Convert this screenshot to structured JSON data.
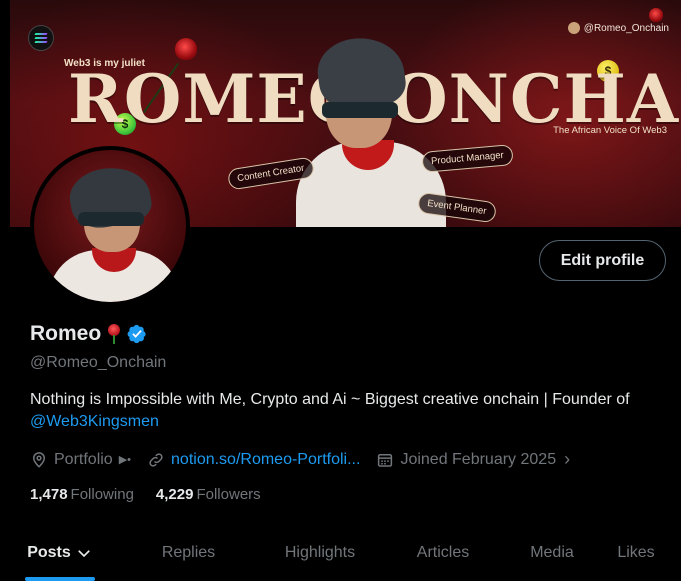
{
  "banner": {
    "tagline_left": "Web3 is my juliet",
    "headline": "ROMEO ONCHAIN",
    "handle": "@Romeo_Onchain",
    "tagline_right": "The African Voice Of Web3",
    "pills": [
      "Content Creator",
      "Product Manager",
      "Event Planner"
    ]
  },
  "profile": {
    "display_name": "Romeo",
    "handle": "@Romeo_Onchain",
    "edit_button": "Edit profile",
    "bio_text": "Nothing is Impossible with Me, Crypto and Ai  ~ Biggest creative onchain | Founder of ",
    "bio_link": "@Web3Kingsmen",
    "location": "Portfolio",
    "website": "notion.so/Romeo-Portfoli...",
    "joined": "Joined February 2025",
    "following_count": "1,478",
    "following_label": "Following",
    "followers_count": "4,229",
    "followers_label": "Followers"
  },
  "tabs": [
    {
      "label": "Posts",
      "active": true
    },
    {
      "label": "Replies",
      "active": false
    },
    {
      "label": "Highlights",
      "active": false
    },
    {
      "label": "Articles",
      "active": false
    },
    {
      "label": "Media",
      "active": false
    },
    {
      "label": "Likes",
      "active": false
    }
  ],
  "colors": {
    "accent": "#1d9bf0",
    "secondary_text": "#71767b",
    "primary_text": "#e7e9ea",
    "background": "#000000"
  }
}
